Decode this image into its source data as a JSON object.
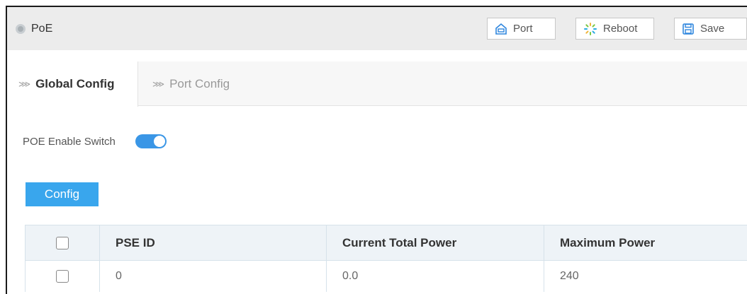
{
  "header": {
    "title": "PoE",
    "buttons": {
      "port": "Port",
      "reboot": "Reboot",
      "save": "Save"
    }
  },
  "tabs": [
    {
      "label": "Global Config",
      "active": true
    },
    {
      "label": "Port Config",
      "active": false
    }
  ],
  "poe_switch": {
    "label": "POE Enable Switch",
    "enabled": true
  },
  "config_button": "Config",
  "table": {
    "headers": [
      "PSE ID",
      "Current Total Power",
      "Maximum Power"
    ],
    "rows": [
      {
        "pse_id": "0",
        "current_total_power": "0.0",
        "maximum_power": "240"
      }
    ]
  },
  "colors": {
    "accent": "#39a6ed",
    "toggle_on": "#3a96e6",
    "header_bg": "#ececec"
  }
}
